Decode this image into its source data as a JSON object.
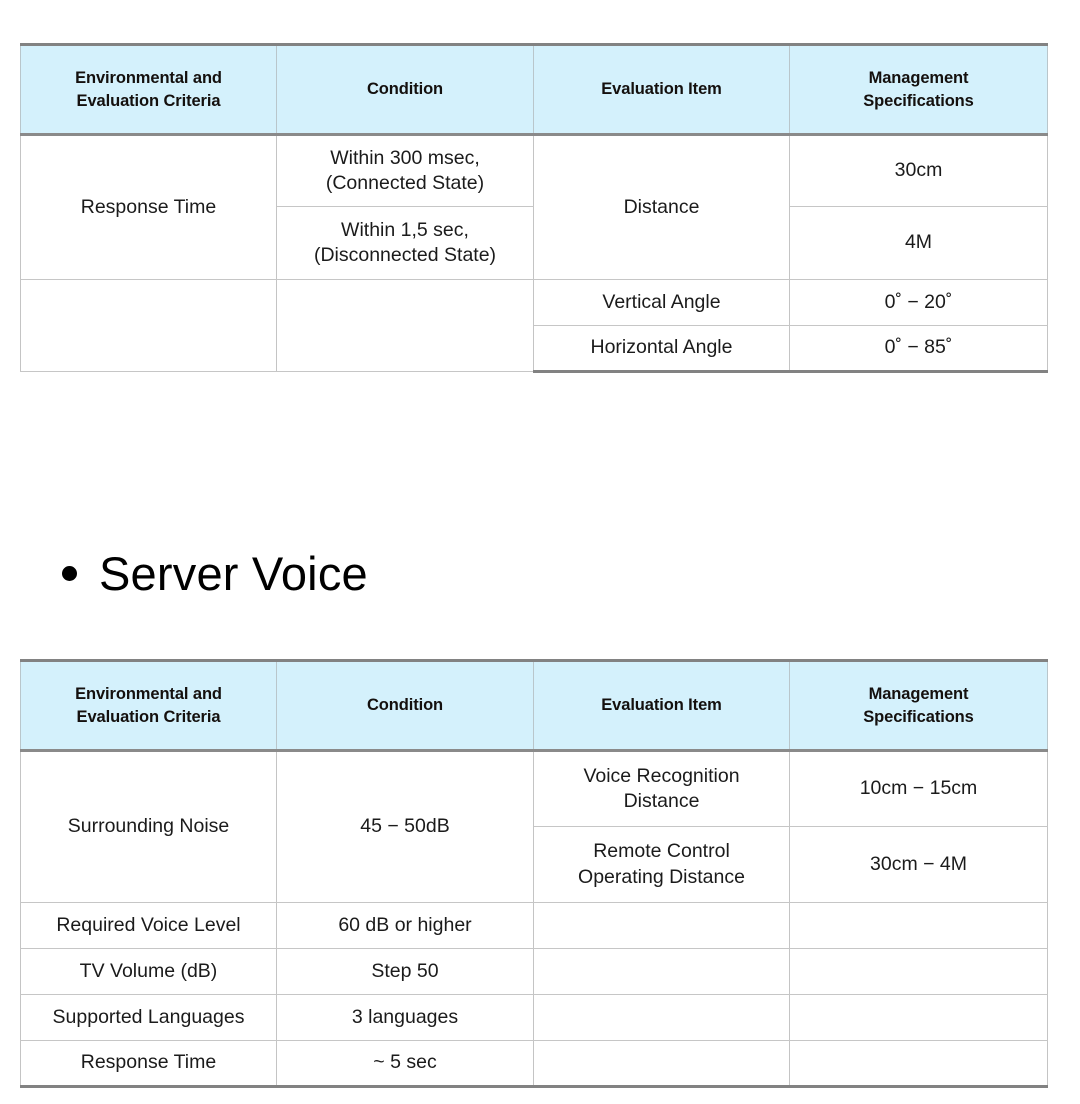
{
  "section_heading": {
    "bullet": "•",
    "text": "Server Voice"
  },
  "tables": [
    {
      "name": "response-time-table",
      "headers": [
        "Environmental and Evaluation Criteria",
        "Condition",
        "Evaluation Item",
        "Management Specifications"
      ],
      "header_lines": [
        [
          "Environmental and",
          "Evaluation Criteria"
        ],
        [
          "Condition"
        ],
        [
          "Evaluation Item"
        ],
        [
          "Management",
          "Specifications"
        ]
      ],
      "rows": [
        {
          "criteria": "Response Time",
          "condition_lines": [
            "Within 300 msec,",
            "(Connected State)"
          ],
          "evaluation_item": "Distance",
          "management_spec": "30cm"
        },
        {
          "criteria": "",
          "condition_lines": [
            "Within 1,5 sec,",
            "(Disconnected State)"
          ],
          "evaluation_item": "",
          "management_spec": "4M"
        },
        {
          "criteria": "",
          "condition_lines": [
            ""
          ],
          "evaluation_item": "Vertical Angle",
          "management_spec": "0˚ − 20˚"
        },
        {
          "criteria": "",
          "condition_lines": [
            ""
          ],
          "evaluation_item": "Horizontal Angle",
          "management_spec": "0˚ − 85˚"
        }
      ]
    },
    {
      "name": "server-voice-table",
      "headers": [
        "Environmental and Evaluation Criteria",
        "Condition",
        "Evaluation Item",
        "Management Specifications"
      ],
      "header_lines": [
        [
          "Environmental and",
          "Evaluation Criteria"
        ],
        [
          "Condition"
        ],
        [
          "Evaluation Item"
        ],
        [
          "Management",
          "Specifications"
        ]
      ],
      "rows": [
        {
          "criteria": "Surrounding Noise",
          "condition_lines": [
            "45 − 50dB"
          ],
          "evaluation_item_lines": [
            "Voice Recognition",
            "Distance"
          ],
          "management_spec": "10cm − 15cm"
        },
        {
          "criteria": "",
          "condition_lines": [
            ""
          ],
          "evaluation_item_lines": [
            "Remote Control",
            "Operating Distance"
          ],
          "management_spec": "30cm − 4M"
        },
        {
          "criteria": "Required Voice Level",
          "condition_lines": [
            "60 dB or higher"
          ],
          "evaluation_item_lines": [
            ""
          ],
          "management_spec": ""
        },
        {
          "criteria": "TV Volume (dB)",
          "condition_lines": [
            "Step 50"
          ],
          "evaluation_item_lines": [
            ""
          ],
          "management_spec": ""
        },
        {
          "criteria": "Supported Languages",
          "condition_lines": [
            "3 languages"
          ],
          "evaluation_item_lines": [
            ""
          ],
          "management_spec": ""
        },
        {
          "criteria": "Response Time",
          "condition_lines": [
            "~ 5 sec"
          ],
          "evaluation_item_lines": [
            ""
          ],
          "management_spec": ""
        }
      ]
    }
  ],
  "colors": {
    "header_fill": "#d4f1fc",
    "heavy_rule": "#828282",
    "light_rule": "#c6c6c6",
    "text": "#1b1b1b"
  }
}
